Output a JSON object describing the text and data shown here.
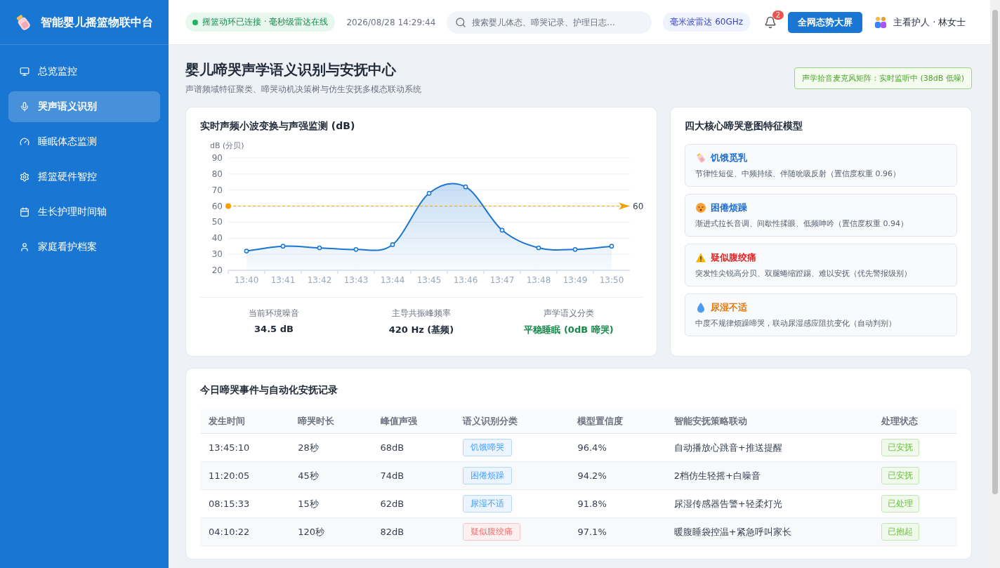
{
  "brand": {
    "title": "智能婴儿摇篮物联中台"
  },
  "sidebar": {
    "items": [
      {
        "label": "总览监控",
        "selected": false
      },
      {
        "label": "哭声语义识别",
        "selected": true
      },
      {
        "label": "睡眠体态监测",
        "selected": false
      },
      {
        "label": "摇篮硬件智控",
        "selected": false
      },
      {
        "label": "生长护理时间轴",
        "selected": false
      },
      {
        "label": "家庭看护档案",
        "selected": false
      }
    ]
  },
  "header": {
    "connection": "摇篮动环已连接 · 毫秒级雷达在线",
    "datetime": "2026/08/28 14:29:44",
    "search": {
      "placeholder": "搜索婴儿体态、啼哭记录、护理日志..."
    },
    "radar_badge": "毫米波雷达 60GHz",
    "notifications": "2",
    "dashboard_button": "全网态势大屏",
    "user": "主看护人 · 林女士"
  },
  "page": {
    "title": "婴儿啼哭声学语义识别与安抚中心",
    "subtitle": "声谱频域特征聚类、啼哭动机决策树与仿生安抚多模态联动系统",
    "status_badge": "声学拾音麦克风矩阵：实时监听中 (38dB 低噪)"
  },
  "monitor": {
    "title": "实时声频小波变换与声强监测 (dB)",
    "chart_data": {
      "type": "area",
      "ylabel": "dB (分贝)",
      "categories": [
        "13:40",
        "13:41",
        "13:42",
        "13:43",
        "13:44",
        "13:45",
        "13:46",
        "13:47",
        "13:48",
        "13:49",
        "13:50"
      ],
      "series": [
        {
          "color": "#1976d2",
          "values": [
            32,
            35,
            34,
            33,
            36,
            68,
            72,
            45,
            34,
            33,
            35
          ]
        }
      ],
      "ylim": [
        20,
        90
      ],
      "yticks": [
        20,
        30,
        40,
        50,
        60,
        70,
        80,
        90
      ],
      "grid": true
    },
    "threshold": {
      "label": "60"
    },
    "stats": [
      {
        "label": "当前环境噪音",
        "value": "34.5 dB",
        "kind": "plain"
      },
      {
        "label": "主导共振峰频率",
        "value": "420 Hz (基频)",
        "kind": "plain"
      },
      {
        "label": "声学语义分类",
        "value": "平稳睡眠 (0dB 啼哭)",
        "kind": "good"
      }
    ]
  },
  "models": {
    "title": "四大核心啼哭意图特征模型",
    "items": [
      {
        "name": "饥饿觅乳",
        "color": "#1f6fd1",
        "desc": "节律性短促、中频持续、伴随吮吸反射（置信度权重 0.96）"
      },
      {
        "name": "困倦烦躁",
        "color": "#1f6fd1",
        "desc": "渐进式拉长音调、间歇性揉眼、低频呻吟（置信度权重 0.94）"
      },
      {
        "name": "疑似腹绞痛",
        "color": "#e02424",
        "desc": "突发性尖锐高分贝、双腿蜷缩蹬踢、难以安抚（优先警报级别）"
      },
      {
        "name": "尿湿不适",
        "color": "#e07a10",
        "desc": "中度不规律烦躁啼哭，联动尿湿感应阻抗变化（自动判别）"
      }
    ]
  },
  "events": {
    "title": "今日啼哭事件与自动化安抚记录",
    "columns": [
      "发生时间",
      "啼哭时长",
      "峰值声强",
      "语义识别分类",
      "模型置信度",
      "智能安抚策略联动",
      "处理状态"
    ],
    "rows": [
      {
        "time": "13:45:10",
        "duration": "28秒",
        "peak": "68dB",
        "category": "饥饿啼哭",
        "kind": "normal",
        "confidence": "96.4%",
        "strategy": "自动播放心跳音+推送提醒",
        "status": "已安抚"
      },
      {
        "time": "11:20:05",
        "duration": "45秒",
        "peak": "74dB",
        "category": "困倦烦躁",
        "kind": "normal",
        "confidence": "94.2%",
        "strategy": "2档仿生轻摇+白噪音",
        "status": "已安抚"
      },
      {
        "time": "08:15:33",
        "duration": "15秒",
        "peak": "62dB",
        "category": "尿湿不适",
        "kind": "normal",
        "confidence": "91.8%",
        "strategy": "尿湿传感器告警+轻柔灯光",
        "status": "已处理"
      },
      {
        "time": "04:10:22",
        "duration": "120秒",
        "peak": "82dB",
        "category": "疑似腹绞痛",
        "kind": "alert",
        "confidence": "97.1%",
        "strategy": "暖腹睡袋控温+紧急呼叫家长",
        "status": "已抱起"
      }
    ]
  }
}
